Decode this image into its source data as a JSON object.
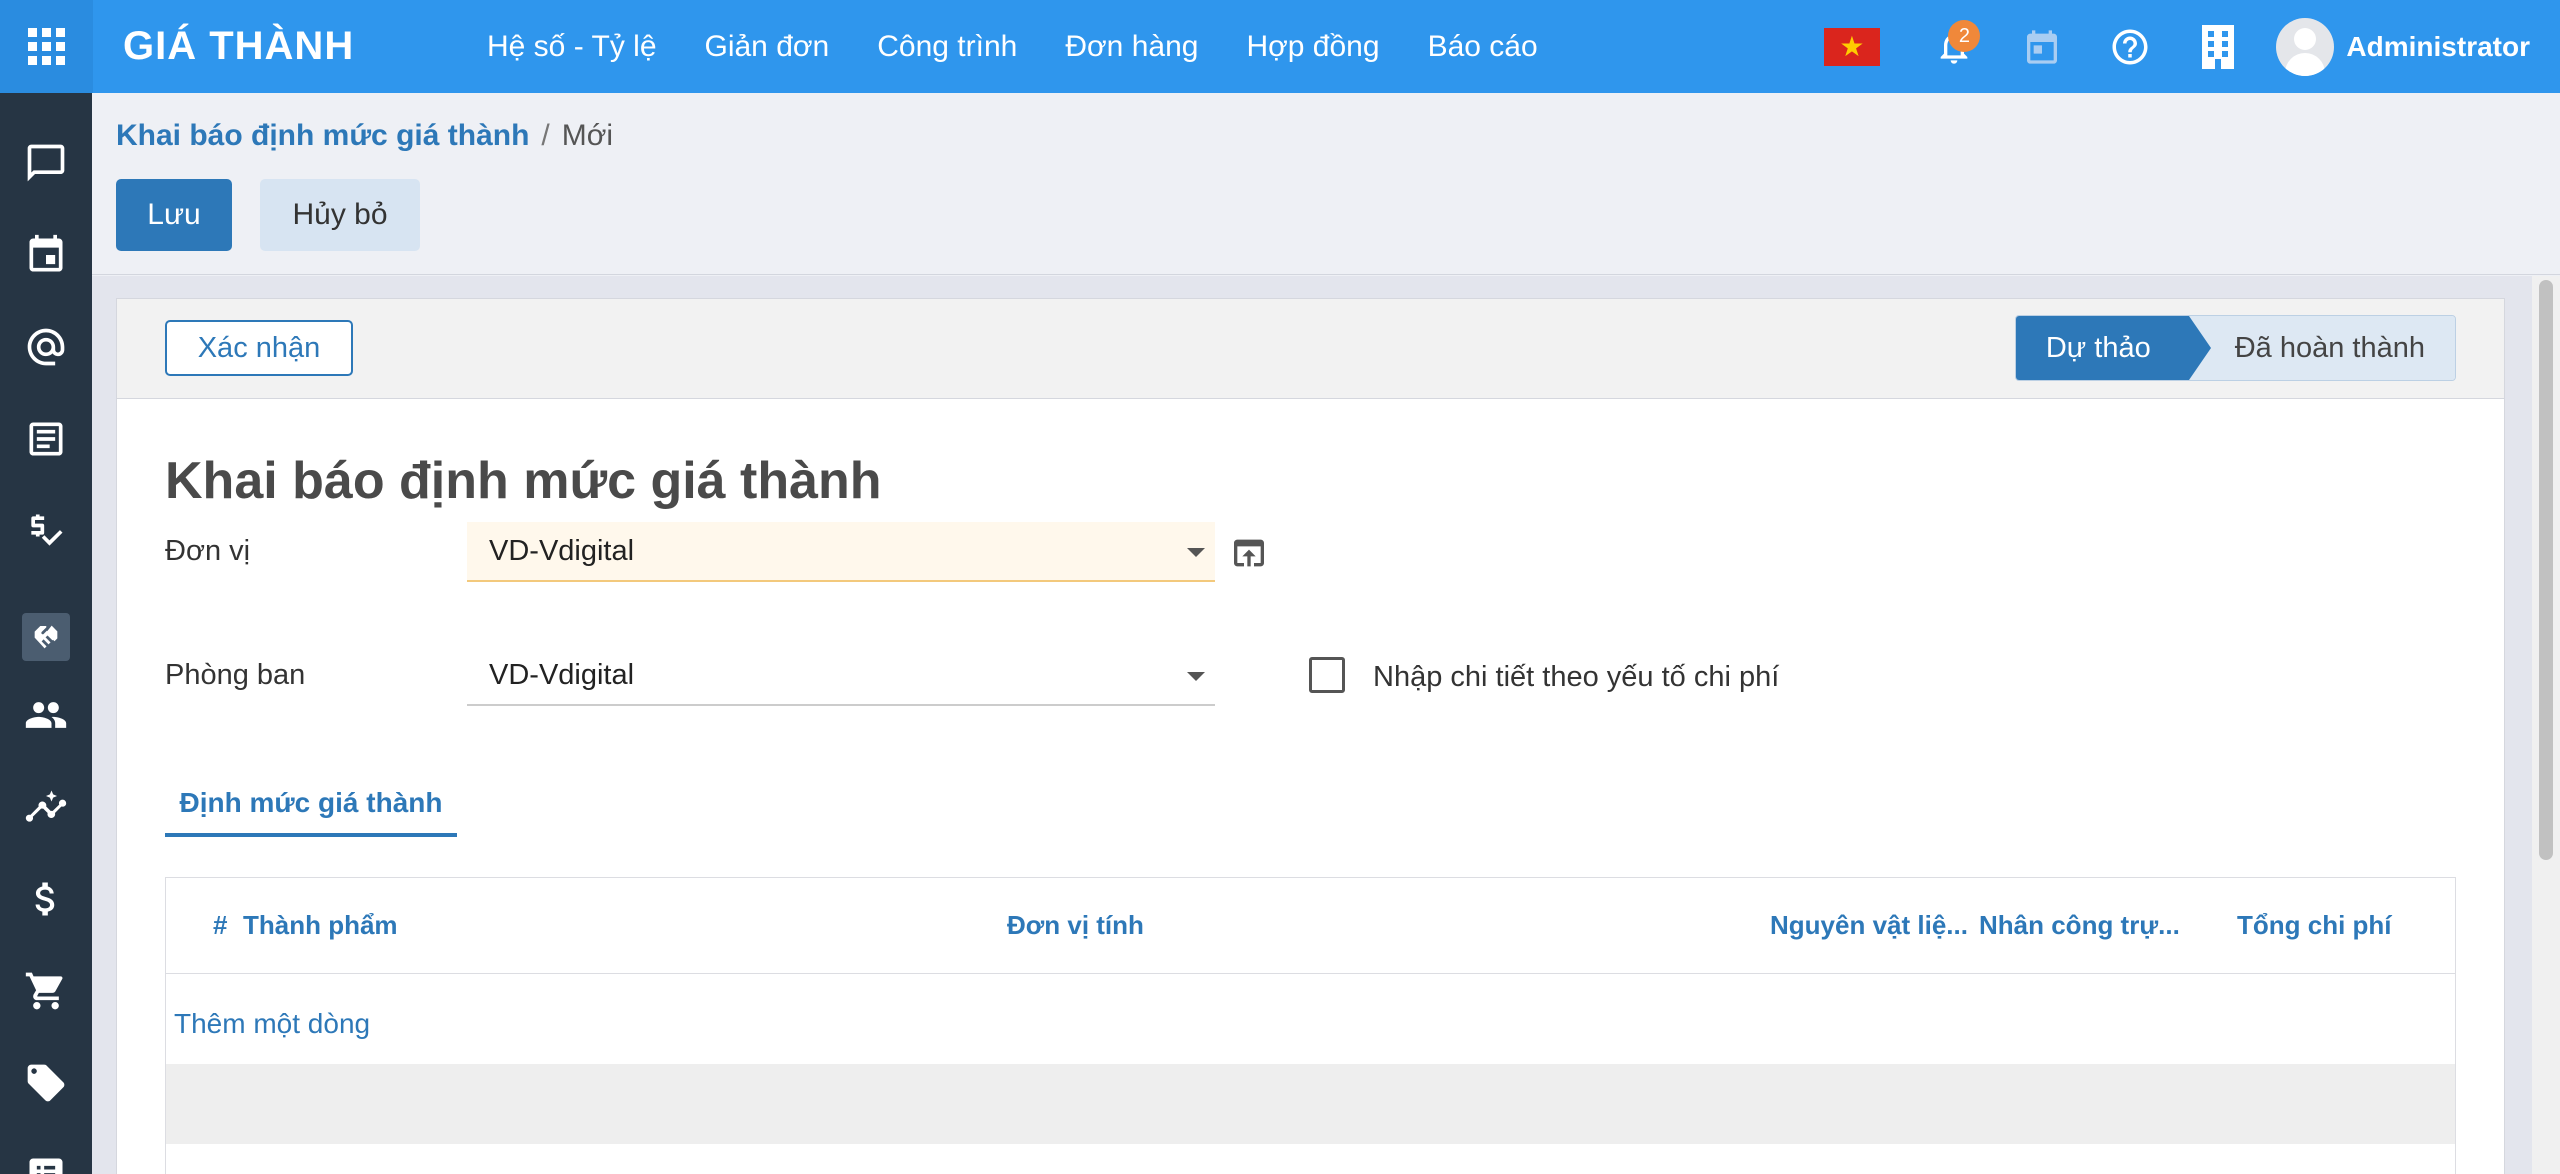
{
  "app": {
    "title": "GIÁ THÀNH",
    "menu": [
      "Hệ số - Tỷ lệ",
      "Giản đơn",
      "Công trình",
      "Đơn hàng",
      "Hợp đồng",
      "Báo cáo"
    ],
    "notification_count": "2",
    "user_name": "Administrator"
  },
  "breadcrumb": {
    "parent": "Khai báo định mức giá thành",
    "separator": "/",
    "current": "Mới"
  },
  "actions": {
    "save": "Lưu",
    "discard": "Hủy bỏ"
  },
  "statusbar": {
    "confirm": "Xác nhận",
    "stages": [
      "Dự thảo",
      "Đã hoàn thành"
    ],
    "active_stage": "Dự thảo"
  },
  "form": {
    "title": "Khai báo định mức giá thành",
    "unit_label": "Đơn vị",
    "unit_value": "VD-Vdigital",
    "department_label": "Phòng ban",
    "department_value": "VD-Vdigital",
    "detail_checkbox_label": "Nhập chi tiết theo yếu tố chi phí",
    "detail_checkbox_checked": false
  },
  "tabs": [
    "Định mức giá thành"
  ],
  "table": {
    "columns": [
      "#",
      "Thành phẩm",
      "Đơn vị tính",
      "Nguyên vật liệ...",
      "Nhân công trự...",
      "Tổng chi phí"
    ],
    "rows": [],
    "add_line": "Thêm một dòng"
  },
  "colors": {
    "topbar": "#2f96ed",
    "accent": "#2d78b8",
    "sidebar": "#263544",
    "badge": "#f0883a"
  }
}
